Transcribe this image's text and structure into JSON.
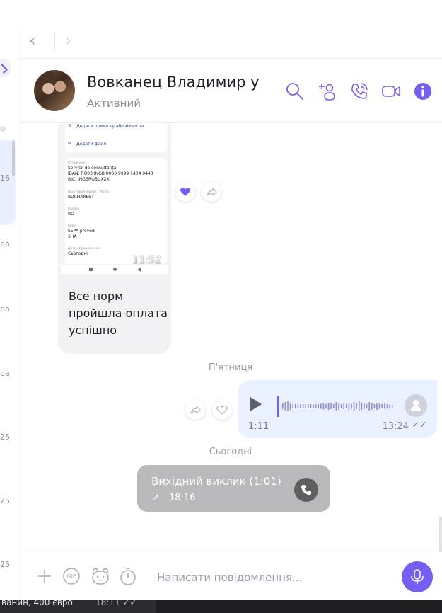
{
  "contact": {
    "name": "Вовканец Владимир у",
    "status": "Активний"
  },
  "nav": {
    "back_icon": "‹",
    "forward_icon": "›"
  },
  "left_list": {
    "item_dates": [
      "16",
      "ра",
      "ра",
      "ра",
      "25",
      "25",
      "25"
    ]
  },
  "image_message": {
    "screenshot": {
      "add_note": "Додати примітку або #хештег",
      "add_file": "Додати файл",
      "recipient_label": "Отримувач",
      "recipient_value": "Servicii de consultanță",
      "iban": "IBAN: RO03 INGB 0000 9999 1404 0443",
      "bic": "BIC: INGBROBUXXX",
      "city_label": "Поштовий індекс / Місто",
      "city_value": "BUCHAREST",
      "country_label": "Країна",
      "country_value": "RO",
      "info_label": "Інфо",
      "info_value": "SEPA převod",
      "charge": "SHA",
      "date_label": "Дата опрацювання",
      "date_value": "Сьогодні",
      "phone_time": "11:52"
    },
    "text": "Все норм пройшла оплата успішно"
  },
  "day_labels": {
    "friday": "П'ятниця",
    "today": "Сьогодні"
  },
  "voice_message": {
    "duration": "1:11",
    "time": "13:24",
    "ticks": "✓✓"
  },
  "call": {
    "title": "Вихідний виклик  (1:01)",
    "arrow": "↗",
    "time": "18:16"
  },
  "composer": {
    "placeholder": "Написати повідомлення..."
  },
  "bottom_strip": {
    "text": "ванин, 400 євро",
    "time": "18:11  ✓✓"
  },
  "colors": {
    "accent": "#7360f2",
    "outgoing_bubble": "#e9f0ff",
    "call_bubble": "#b9b9bd"
  },
  "icons": {
    "header": [
      "search-icon",
      "add-participant-icon",
      "call-icon",
      "video-call-icon",
      "info-icon"
    ],
    "composer": [
      "plus-icon",
      "gif-icon",
      "sticker-icon",
      "timer-icon",
      "microphone-icon"
    ]
  }
}
